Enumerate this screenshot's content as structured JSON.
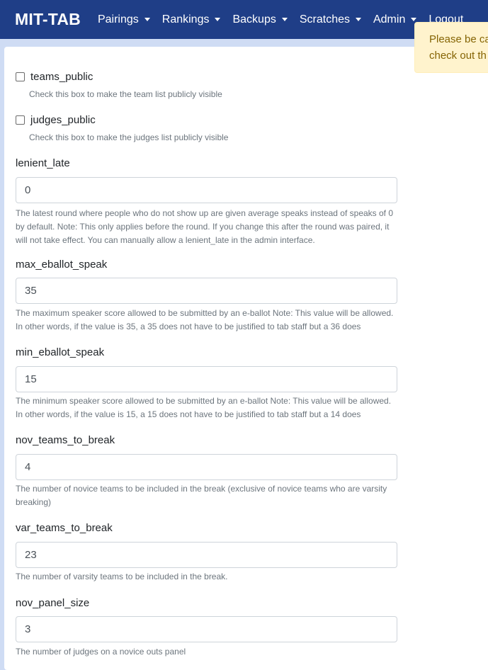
{
  "nav": {
    "brand": "MIT-TAB",
    "items": [
      "Pairings",
      "Rankings",
      "Backups",
      "Scratches",
      "Admin"
    ],
    "logout": "Logout"
  },
  "alert": {
    "line1": "Please be ca",
    "line2": "check out th"
  },
  "checkboxes": [
    {
      "label": "teams_public",
      "help": "Check this box to make the team list publicly visible",
      "checked": false
    },
    {
      "label": "judges_public",
      "help": "Check this box to make the judges list publicly visible",
      "checked": false
    }
  ],
  "fields": [
    {
      "label": "lenient_late",
      "value": "0",
      "help": "The latest round where people who do not show up are given average speaks instead of speaks of 0 by default. Note: This only applies before the round. If you change this after the round was paired, it will not take effect. You can manually allow a lenient_late in the admin interface."
    },
    {
      "label": "max_eballot_speak",
      "value": "35",
      "help": "The maximum speaker score allowed to be submitted by an e-ballot Note: This value will be allowed. In other words, if the value is 35, a 35 does not have to be justified to tab staff but a 36 does"
    },
    {
      "label": "min_eballot_speak",
      "value": "15",
      "help": "The minimum speaker score allowed to be submitted by an e-ballot Note: This value will be allowed. In other words, if the value is 15, a 15 does not have to be justified to tab staff but a 14 does"
    },
    {
      "label": "nov_teams_to_break",
      "value": "4",
      "help": "The number of novice teams to be included in the break (exclusive of novice teams who are varsity breaking)"
    },
    {
      "label": "var_teams_to_break",
      "value": "23",
      "help": "The number of varsity teams to be included in the break."
    },
    {
      "label": "nov_panel_size",
      "value": "3",
      "help": "The number of judges on a novice outs panel"
    }
  ],
  "colors": {
    "navbar": "#1f3e87",
    "alert_bg": "#fff3cd",
    "alert_text": "#856404"
  }
}
